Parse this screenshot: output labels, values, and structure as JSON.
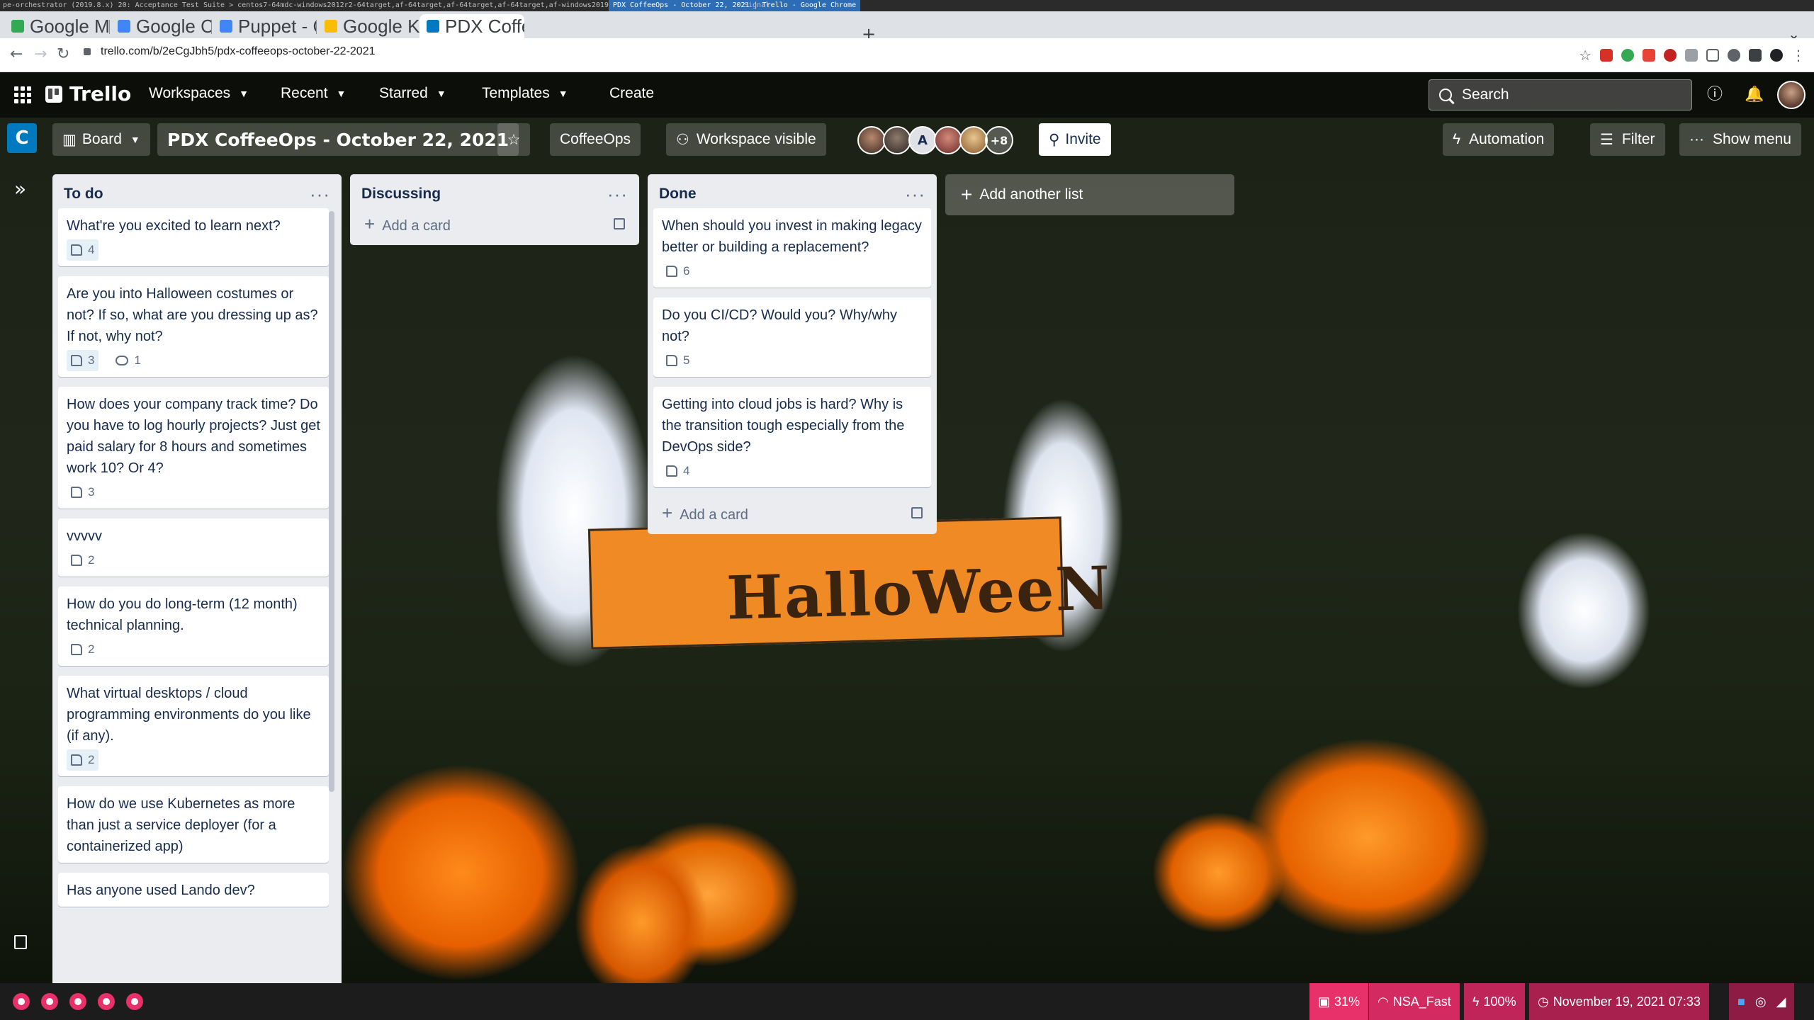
{
  "os_top": {
    "left_text": "pe-orchestrator (2019.8.x) 20: Acceptance Test Suite > centos7-64mdc-windows2012r2-64target,af-64target,af-64target,af-64target,af-windows2019",
    "active_text": "PDX CoffeeOps - October 22, 2021 | Trello - Google Chrome",
    "right_text": "Signal"
  },
  "browser": {
    "tabs": [
      {
        "label": "Google Maps",
        "favicon_color": "#34a853"
      },
      {
        "label": "Google Calendar",
        "favicon_color": "#4285f4"
      },
      {
        "label": "Puppet - Calendar",
        "favicon_color": "#4285f4"
      },
      {
        "label": "Google Keep",
        "favicon_color": "#fbbc04"
      },
      {
        "label": "PDX CoffeeOps",
        "favicon_color": "#0079bf"
      }
    ],
    "url": "trello.com/b/2eCgJbh5/pdx-coffeeops-october-22-2021"
  },
  "trello": {
    "logo": "Trello",
    "nav": [
      "Workspaces",
      "Recent",
      "Starred",
      "Templates"
    ],
    "create_label": "Create",
    "search_placeholder": "Search",
    "board": {
      "workspace_initial": "C",
      "view_label": "Board",
      "title": "PDX CoffeeOps - October 22, 2021",
      "workspace_name": "CoffeeOps",
      "visibility": "Workspace visible",
      "member_initial": "A",
      "more_members": "+8",
      "invite_label": "Invite",
      "automation_label": "Automation",
      "filter_label": "Filter",
      "show_menu_label": "Show menu"
    },
    "add_card_label": "Add a card",
    "add_list_label": "Add another list",
    "lists": [
      {
        "title": "To do",
        "cards": [
          {
            "text": "What're you excited to learn next?",
            "votes": "4",
            "voted": true
          },
          {
            "text": "Are you into Halloween costumes or not? If so, what are you dressing up as? If not, why not?",
            "votes": "3",
            "voted": true,
            "comments": "1"
          },
          {
            "text": "How does your company track time? Do you have to log hourly projects? Just get paid salary for 8 hours and sometimes work 10? Or 4?",
            "votes": "3",
            "voted": false
          },
          {
            "text": "vvvvv",
            "votes": "2",
            "voted": false
          },
          {
            "text": "How do you do long-term (12 month) technical planning.",
            "votes": "2",
            "voted": false
          },
          {
            "text": "What virtual desktops / cloud programming environments do you like (if any).",
            "votes": "2",
            "voted": true
          },
          {
            "text": "How do we use Kubernetes as more than just a service deployer (for a containerized app)",
            "votes": "",
            "voted": false
          },
          {
            "text": "Has anyone used Lando dev?",
            "votes": "",
            "voted": false
          }
        ]
      },
      {
        "title": "Discussing",
        "cards": []
      },
      {
        "title": "Done",
        "cards": [
          {
            "text": "When should you invest in making legacy better or building a replacement?",
            "votes": "6",
            "voted": false
          },
          {
            "text": "Do you CI/CD? Would you? Why/why not?",
            "votes": "5",
            "voted": false
          },
          {
            "text": "Getting into cloud jobs is hard? Why is the transition tough especially from the DevOps side?",
            "votes": "4",
            "voted": false
          }
        ]
      }
    ],
    "background_sign_text": "HalloWeeN"
  },
  "os_bottom": {
    "disk": "31%",
    "wifi": "NSA_Fast",
    "battery": "100%",
    "datetime": "November 19, 2021 07:33"
  },
  "colors": {
    "trello_blue": "#0079bf",
    "list_bg": "#ebecf0",
    "os_accent": "#e8306a"
  }
}
